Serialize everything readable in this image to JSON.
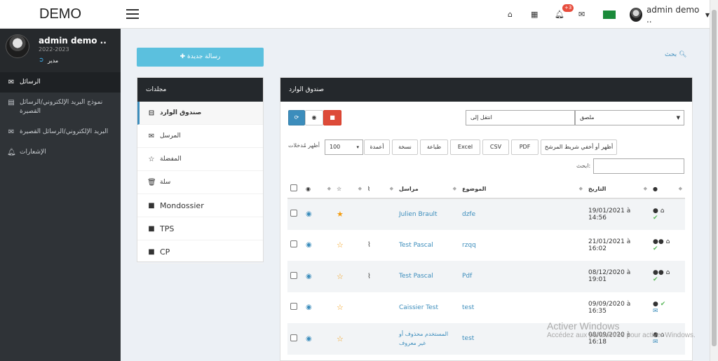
{
  "brand": "DEMO",
  "topbar": {
    "badge": "+3",
    "user": "admin demo .."
  },
  "sidebar": {
    "user_name": "admin demo ..",
    "year": "2022-2023",
    "role": "مدير",
    "items": [
      {
        "label": "الرسائل"
      },
      {
        "label": "نموذج البريد الإلكتروني/الرسائل القصيرة"
      },
      {
        "label": "البريد الإلكتروني/الرسائل القصيرة"
      },
      {
        "label": "الإشعارات"
      }
    ]
  },
  "new_message": "رسالة جديدة",
  "search_link": "بحث",
  "folders": {
    "title": "مجلدات",
    "items": [
      {
        "label": "صندوق الوارد"
      },
      {
        "label": "المرسل"
      },
      {
        "label": "المفضلة"
      },
      {
        "label": "سلة"
      },
      {
        "label": "Mondossier"
      },
      {
        "label": "TPS"
      },
      {
        "label": "CP"
      }
    ]
  },
  "inbox": {
    "title": "صندوق الوارد",
    "move_to": "انتقل إلى",
    "label_select": "ملصق",
    "show_entries": "أظهر مُدخلات",
    "page_size": "100",
    "export_buttons": [
      "أعمدة",
      "نسخة",
      "طباعة",
      "Excel",
      "CSV",
      "PDF",
      "أظهر أو أخفي شريط المرشح"
    ],
    "search_label": "ابحث:",
    "columns": {
      "sender": "مراسل",
      "subject": "الموضوع",
      "date": "التاريخ"
    },
    "rows": [
      {
        "sender": "Julien Brault",
        "subject": "dzfe",
        "date1": "19/01/2021 à",
        "date2": "14:56",
        "starred": true,
        "attach": false
      },
      {
        "sender": "Test Pascal",
        "subject": "rzqq",
        "date1": "21/01/2021 à",
        "date2": "16:02",
        "starred": false,
        "attach": true
      },
      {
        "sender": "Test Pascal",
        "subject": "Pdf",
        "date1": "08/12/2020 à",
        "date2": "19:01",
        "starred": false,
        "attach": true
      },
      {
        "sender": "Caissier Test",
        "subject": "test",
        "date1": "09/09/2020 à",
        "date2": "16:35",
        "starred": false,
        "attach": false
      },
      {
        "sender": "المستخدم محذوف أو غير معروف",
        "subject": "test",
        "date1": "08/09/2020 à",
        "date2": "16:18",
        "starred": false,
        "attach": false
      }
    ]
  },
  "watermark": {
    "line1": "Activer Windows",
    "line2": "Accédez aux paramètres pour activer Windows."
  }
}
